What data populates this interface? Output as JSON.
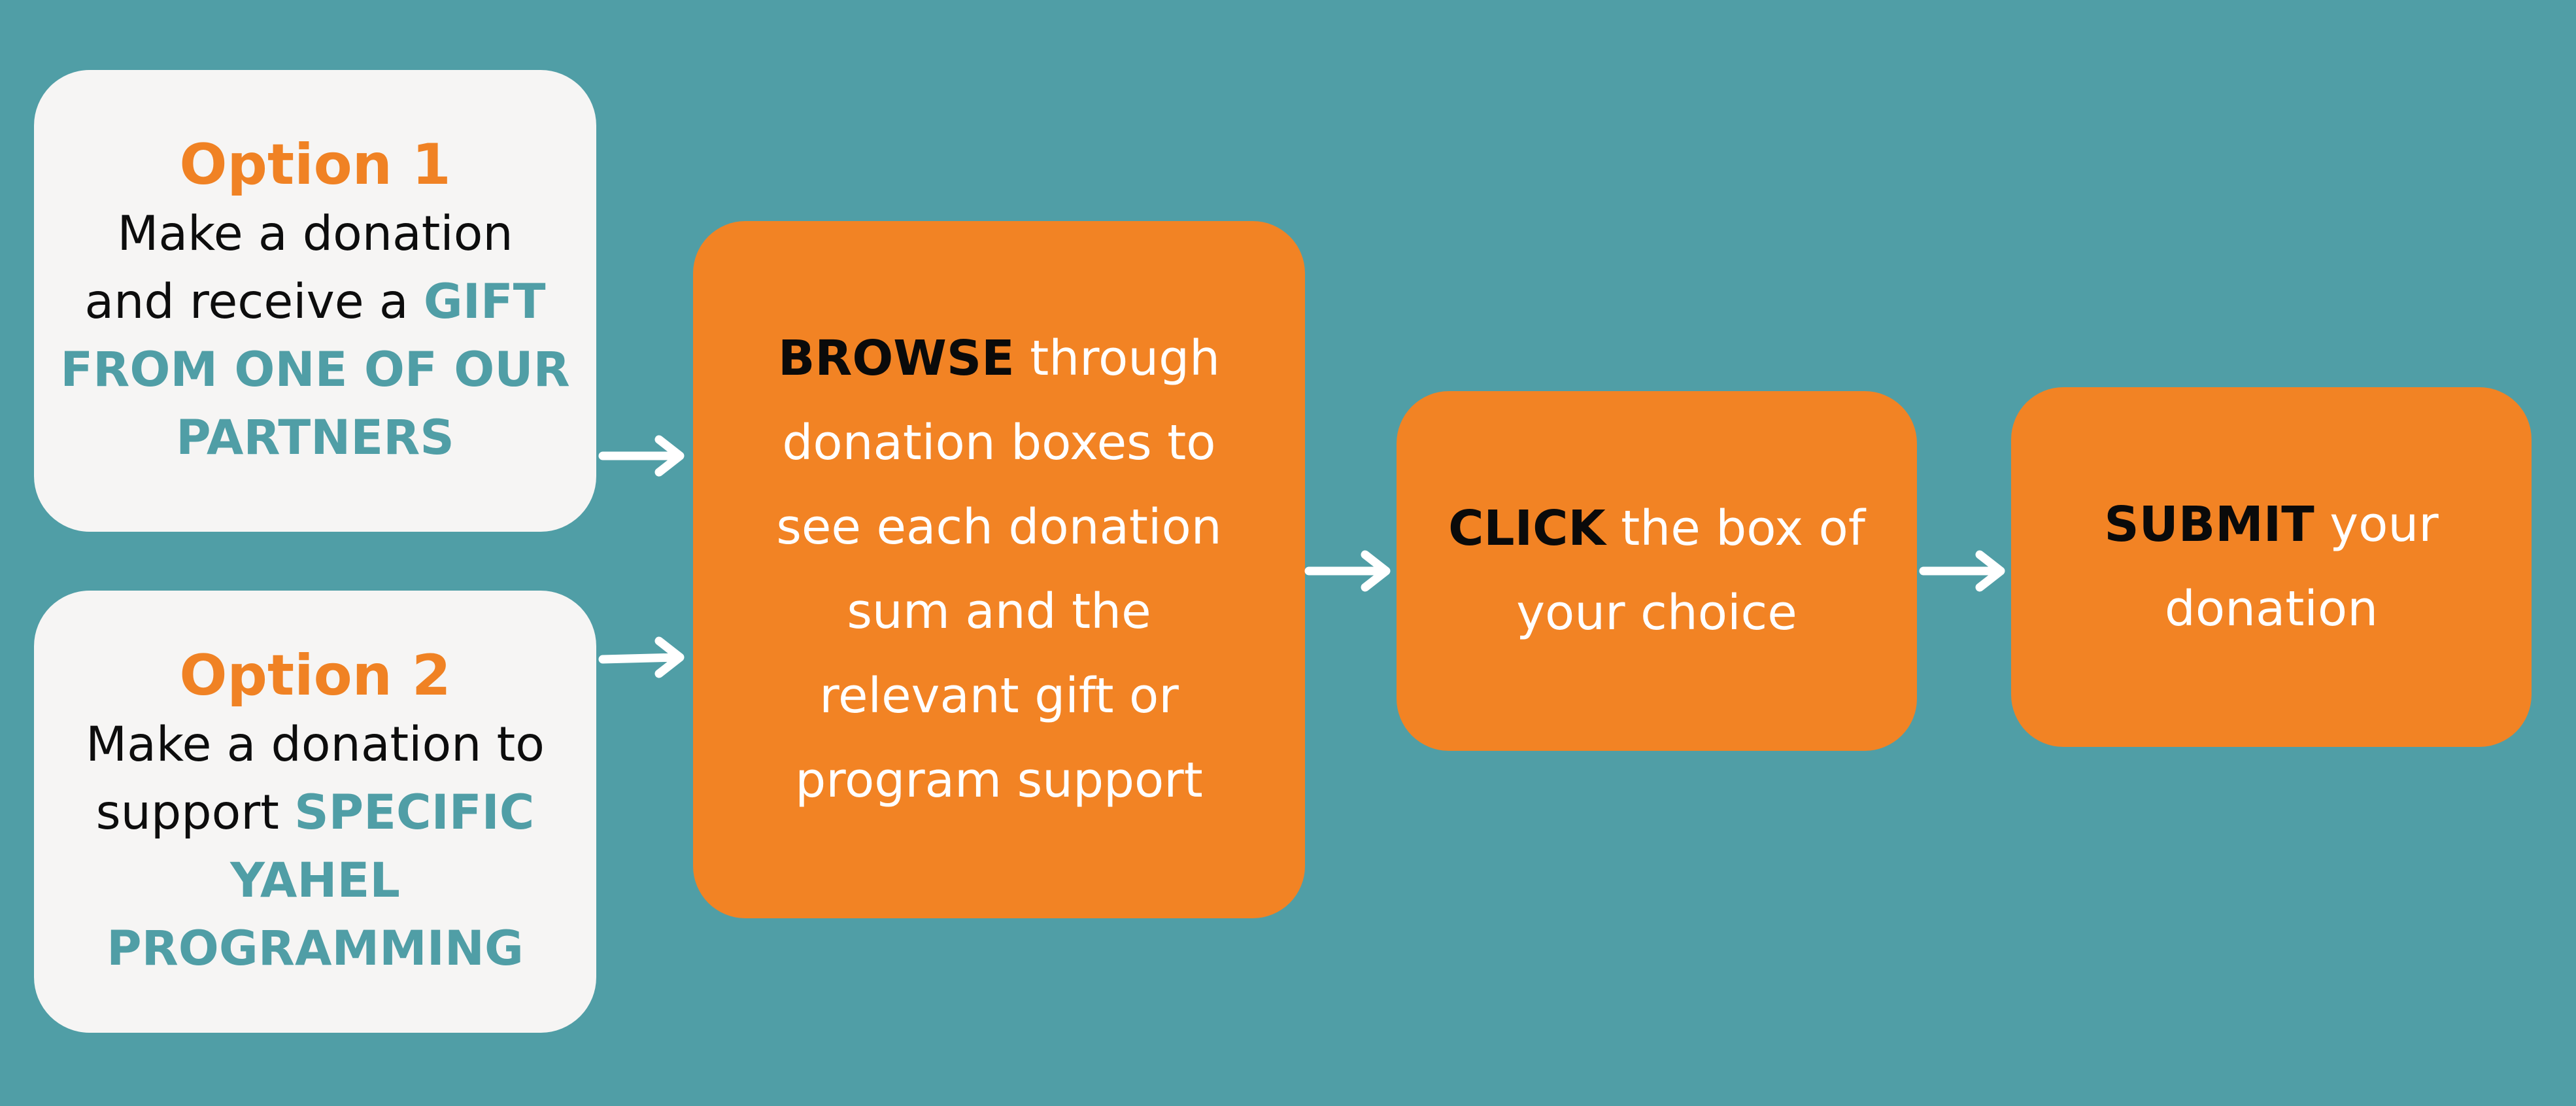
{
  "colors": {
    "background": "#509ea6",
    "option_box": "#f6f5f4",
    "step_box": "#f28324",
    "option_title": "#f08224",
    "accent_teal": "#509ea6",
    "arrow": "#ffffff"
  },
  "option1": {
    "title": "Option 1",
    "line1": "Make a donation",
    "line2_prefix": "and receive a ",
    "line2_accent": "GIFT",
    "line3": "FROM ONE OF OUR",
    "line4": "PARTNERS"
  },
  "option2": {
    "title": "Option 2",
    "line1": "Make a donation to",
    "line2_prefix": "support ",
    "line2_accent": "SPECIFIC",
    "line3": "YAHEL",
    "line4": "PROGRAMMING"
  },
  "steps": {
    "browse": {
      "keyword": "BROWSE",
      "line1_rest": " through",
      "line2": "donation boxes to",
      "line3": "see each donation",
      "line4": "sum and the",
      "line5": "relevant gift or",
      "line6": "program support"
    },
    "click": {
      "keyword": "CLICK",
      "line1_rest": " the box of",
      "line2": "your choice"
    },
    "submit": {
      "keyword": "SUBMIT",
      "line1_rest": " your",
      "line2": "donation"
    }
  }
}
